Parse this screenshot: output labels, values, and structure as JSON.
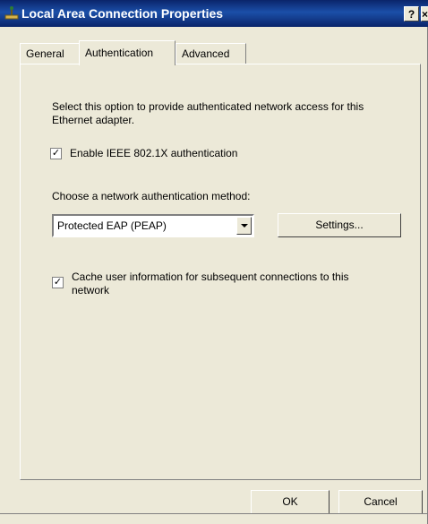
{
  "window": {
    "title": "Local Area Connection Properties",
    "help_glyph": "?",
    "close_glyph": "×"
  },
  "tabs": [
    {
      "label": "General",
      "active": false
    },
    {
      "label": "Authentication",
      "active": true
    },
    {
      "label": "Advanced",
      "active": false
    }
  ],
  "authentication": {
    "description": "Select this option to provide authenticated network access for this Ethernet adapter.",
    "enable_8021x": {
      "label": "Enable IEEE 802.1X authentication",
      "checked": true
    },
    "method_label": "Choose a network authentication method:",
    "method_select": {
      "value": "Protected EAP (PEAP)"
    },
    "settings_button": "Settings...",
    "cache_user_info": {
      "label": "Cache user information for subsequent connections to this network",
      "checked": true
    },
    "check_glyph": "✓"
  },
  "footer": {
    "ok_label": "OK",
    "cancel_label": "Cancel"
  },
  "colors": {
    "title_bar": "#0a246a",
    "dialog_face": "#ece9d8"
  }
}
